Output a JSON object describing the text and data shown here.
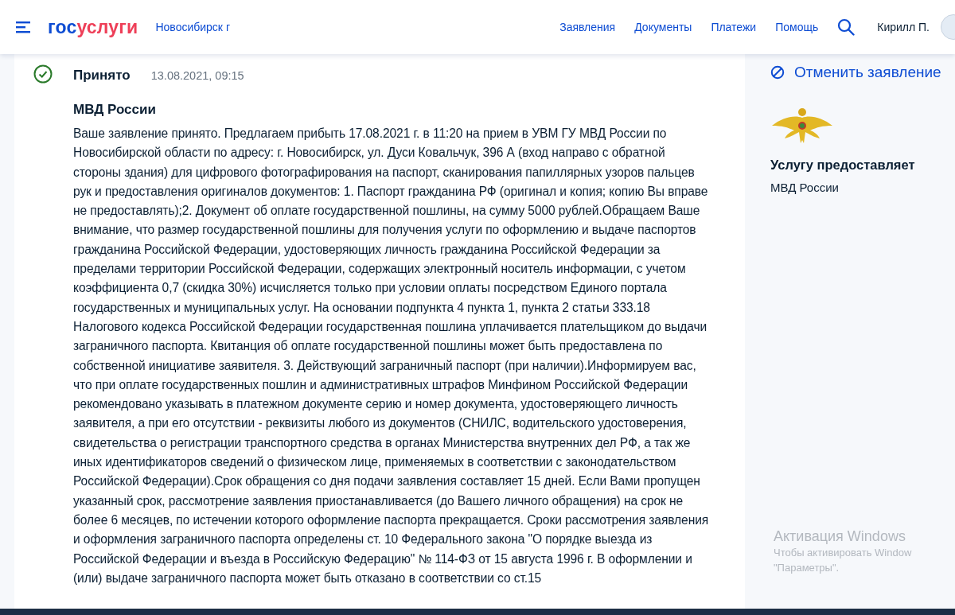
{
  "header": {
    "logo": "госуслуги",
    "city": "Новосибирск г",
    "nav": [
      "Заявления",
      "Документы",
      "Платежи",
      "Помощь"
    ],
    "user": "Кирилл П."
  },
  "status": {
    "kind": "accepted",
    "label": "Принято",
    "datetime": "13.08.2021, 09:15"
  },
  "message": {
    "title": "МВД России",
    "text": "Ваше заявление принято. Предлагаем прибыть 17.08.2021 г. в 11:20 на прием в УВМ ГУ МВД России по Новосибирской области по адресу: г. Новосибирск, ул. Дуси Ковальчук, 396 А (вход направо с обратной стороны здания) для цифрового фотографирования на паспорт, сканирования папиллярных узоров пальцев рук и предоставления оригиналов документов: 1. Паспорт гражданина РФ (оригинал и копия; копию Вы вправе не предоставлять);2. Документ об оплате государственной пошлины, на сумму 5000 рублей.Обращаем Ваше внимание, что размер государственной пошлины для получения услуги по оформлению и выдаче паспортов гражданина Российской Федерации, удостоверяющих личность гражданина Российской Федерации за пределами территории Российской Федерации, содержащих электронный носитель информации, с учетом коэффициента 0,7 (скидка 30%) исчисляется только при условии оплаты посредством Единого портала государственных и муниципальных услуг. На основании подпункта 4 пункта 1, пункта 2 статьи 333.18 Налогового кодекса Российской Федерации государственная пошлина уплачивается плательщиком до выдачи заграничного паспорта. Квитанция об оплате государственной пошлины может быть предоставлена по собственной инициативе заявителя. 3. Действующий заграничный паспорт (при наличии).Информируем вас, что при оплате государственных пошлин и административных штрафов Минфином Российской Федерации рекомендовано указывать в платежном документе серию и номер документа, удостоверяющего личность заявителя, а при его отсутствии - реквизиты любого из документов (СНИЛС, водительского удостоверения, свидетельства о регистрации транспортного средства в органах Министерства внутренних дел РФ, а так же иных идентификаторов сведений о физическом лице, применяемых в соответствии с законодательством Российской Федерации).Срок обращения со дня подачи заявления составляет 15 дней. Если Вами пропущен указанный срок, рассмотрение заявления приостанавливается (до Вашего личного обращения) на срок не более 6 месяцев, по истечении которого оформление паспорта прекращается. Сроки рассмотрения заявления и оформления заграничного паспорта определены ст. 10 Федерального закона \"О порядке выезда из Российской Федерации и въезда в Российскую Федерацию\" № 114-ФЗ от 15 августа 1996 г. В оформлении и (или) выдаче заграничного паспорта может быть отказано в соответствии со ст.15"
  },
  "sidebar": {
    "cancel": "Отменить заявление",
    "provider_heading": "Услугу предоставляет",
    "provider": "МВД России"
  },
  "windows_activation": {
    "title": "Активация Windows",
    "text": "Чтобы активировать Window\n\"Параметры\"."
  }
}
